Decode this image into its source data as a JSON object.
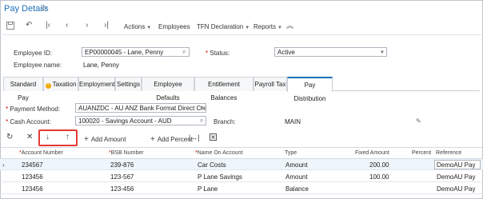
{
  "header": {
    "title": "Pay Details"
  },
  "toolbar": {
    "actions": "Actions",
    "employees": "Employees",
    "tfn_declaration": "TFN Declaration",
    "reports": "Reports"
  },
  "form": {
    "employee_id_label": "Employee ID:",
    "employee_id_value": "EP00000045 - Lane, Penny",
    "employee_name_label": "Employee name:",
    "employee_name_value": "Lane, Penny",
    "status_label": "Status:",
    "status_value": "Active"
  },
  "tabs": [
    "Standard Pay",
    "Taxation",
    "Employment",
    "Settings",
    "Employee Defaults",
    "Entitlement Balances",
    "Payroll Tax",
    "Pay Distribution"
  ],
  "payment": {
    "method_label": "Payment Method:",
    "method_value": "AUANZDC - AU ANZ Bank Format Direct Credi",
    "cash_account_label": "Cash Account:",
    "cash_account_value": "100020 - Savings Account - AUD",
    "branch_label": "Branch:",
    "branch_value": "MAIN"
  },
  "grid_toolbar": {
    "add_amount": "Add Amount",
    "add_percent": "Add Percent"
  },
  "grid": {
    "columns": [
      "Account Number",
      "BSB Number",
      "Name On Account",
      "Type",
      "Fixed Amount",
      "Percent",
      "Reference"
    ],
    "rows": [
      [
        "234567",
        "239-876",
        "Car Costs",
        "Amount",
        "200.00",
        "",
        "DemoAU Pay"
      ],
      [
        "123456",
        "123-567",
        "P Lane Savings",
        "Amount",
        "100.00",
        "",
        "DemoAU Pay"
      ],
      [
        "123456",
        "123-456",
        "P Lane",
        "Balance",
        "",
        "",
        "DemoAU Pay"
      ]
    ]
  },
  "colors": {
    "accent": "#1b6fb8",
    "highlight": "#e53935",
    "required": "#cc0000"
  }
}
